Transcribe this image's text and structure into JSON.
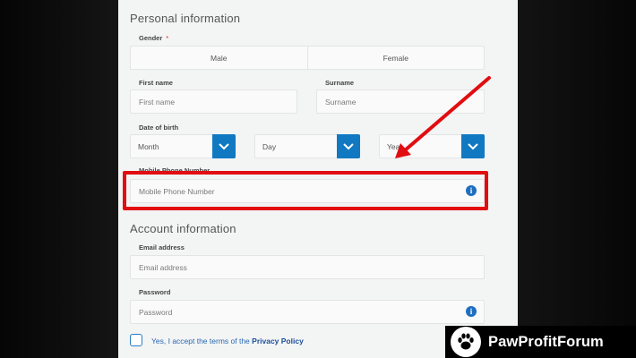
{
  "personal": {
    "title": "Personal information",
    "gender_label": "Gender",
    "required_mark": "*",
    "gender_options": [
      "Male",
      "Female"
    ],
    "first_name_label": "First name",
    "first_name_placeholder": "First name",
    "surname_label": "Surname",
    "surname_placeholder": "Surname",
    "dob_label": "Date of birth",
    "month": "Month",
    "day": "Day",
    "year": "Year",
    "mobile_label": "Mobile Phone Number",
    "mobile_placeholder": "Mobile Phone Number"
  },
  "account": {
    "title": "Account information",
    "email_label": "Email address",
    "email_placeholder": "Email address",
    "password_label": "Password",
    "password_placeholder": "Password"
  },
  "consent": {
    "text": "Yes, I accept the terms of the",
    "link": "Privacy Policy"
  },
  "icons": {
    "info": "i",
    "dropdown": "chevron-down-icon"
  },
  "annotation": {
    "highlight_color": "#e10d10",
    "arrow_color": "#e10d10"
  },
  "watermark": {
    "brand": "PawProfitForum"
  },
  "colors": {
    "accent": "#1179c1",
    "panel": "#f3f4f4"
  }
}
